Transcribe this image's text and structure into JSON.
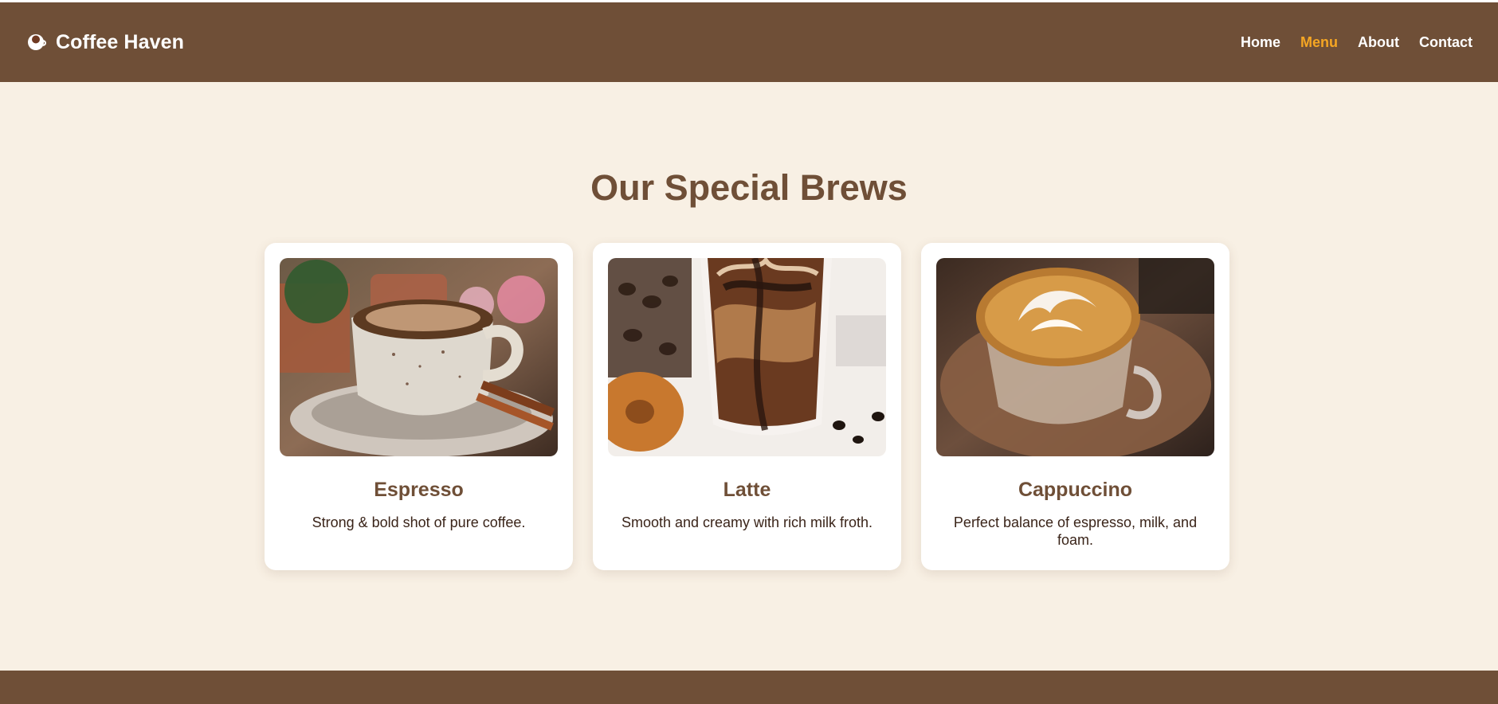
{
  "header": {
    "brand_icon": "coffee-cup-icon",
    "brand_name": "Coffee Haven",
    "nav": [
      {
        "label": "Home",
        "active": false
      },
      {
        "label": "Menu",
        "active": true
      },
      {
        "label": "About",
        "active": false
      },
      {
        "label": "Contact",
        "active": false
      }
    ]
  },
  "section": {
    "title": "Our Special Brews"
  },
  "cards": [
    {
      "title": "Espresso",
      "description": "Strong & bold shot of pure coffee."
    },
    {
      "title": "Latte",
      "description": "Smooth and creamy with rich milk froth."
    },
    {
      "title": "Cappuccino",
      "description": "Perfect balance of espresso, milk, and foam."
    }
  ],
  "colors": {
    "brand_brown": "#6f4f37",
    "page_background": "#f8f0e4",
    "nav_active": "#f5a623",
    "card_background": "#ffffff",
    "text_dark": "#3a2419"
  }
}
